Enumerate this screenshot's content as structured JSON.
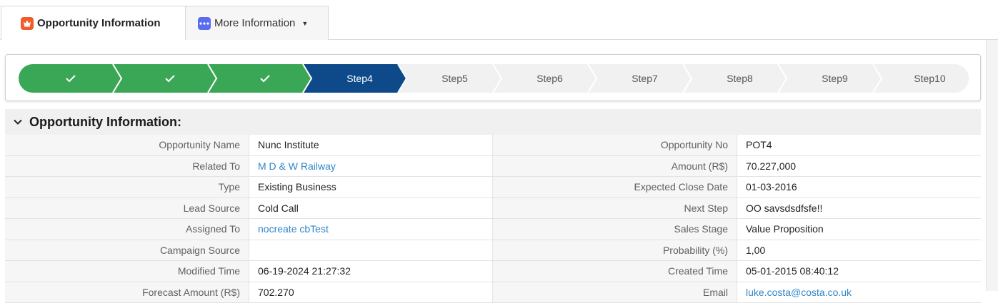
{
  "tabs": {
    "active": {
      "label": "Opportunity Information",
      "icon": "crown-icon"
    },
    "more": {
      "label": "More Information",
      "icon": "dots-icon"
    }
  },
  "stepper": {
    "completed_color": "#3aa757",
    "current_color": "#0e4a8a",
    "pending_color": "#f1f1f1",
    "steps": [
      {
        "label": "",
        "state": "done"
      },
      {
        "label": "",
        "state": "done"
      },
      {
        "label": "",
        "state": "done"
      },
      {
        "label": "Step4",
        "state": "current"
      },
      {
        "label": "Step5",
        "state": "pending"
      },
      {
        "label": "Step6",
        "state": "pending"
      },
      {
        "label": "Step7",
        "state": "pending"
      },
      {
        "label": "Step8",
        "state": "pending"
      },
      {
        "label": "Step9",
        "state": "pending"
      },
      {
        "label": "Step10",
        "state": "pending"
      }
    ]
  },
  "section": {
    "title": "Opportunity Information:"
  },
  "fields": [
    [
      {
        "label": "Opportunity Name",
        "value": "Nunc Institute"
      },
      {
        "label": "Opportunity No",
        "value": "POT4"
      }
    ],
    [
      {
        "label": "Related To",
        "value": "M D & W Railway",
        "link": true
      },
      {
        "label": "Amount (R$)",
        "value": "70.227,000"
      }
    ],
    [
      {
        "label": "Type",
        "value": "Existing Business"
      },
      {
        "label": "Expected Close Date",
        "value": "01-03-2016"
      }
    ],
    [
      {
        "label": "Lead Source",
        "value": "Cold Call"
      },
      {
        "label": "Next Step",
        "value": "OO savsdsdfsfe!!"
      }
    ],
    [
      {
        "label": "Assigned To",
        "value": "nocreate cbTest",
        "link": true
      },
      {
        "label": "Sales Stage",
        "value": "Value Proposition"
      }
    ],
    [
      {
        "label": "Campaign Source",
        "value": ""
      },
      {
        "label": "Probability (%)",
        "value": "1,00"
      }
    ],
    [
      {
        "label": "Modified Time",
        "value": "06-19-2024 21:27:32"
      },
      {
        "label": "Created Time",
        "value": "05-01-2015 08:40:12"
      }
    ],
    [
      {
        "label": "Forecast Amount (R$)",
        "value": "702.270"
      },
      {
        "label": "Email",
        "value": "luke.costa@costa.co.uk",
        "link": true
      }
    ]
  ]
}
